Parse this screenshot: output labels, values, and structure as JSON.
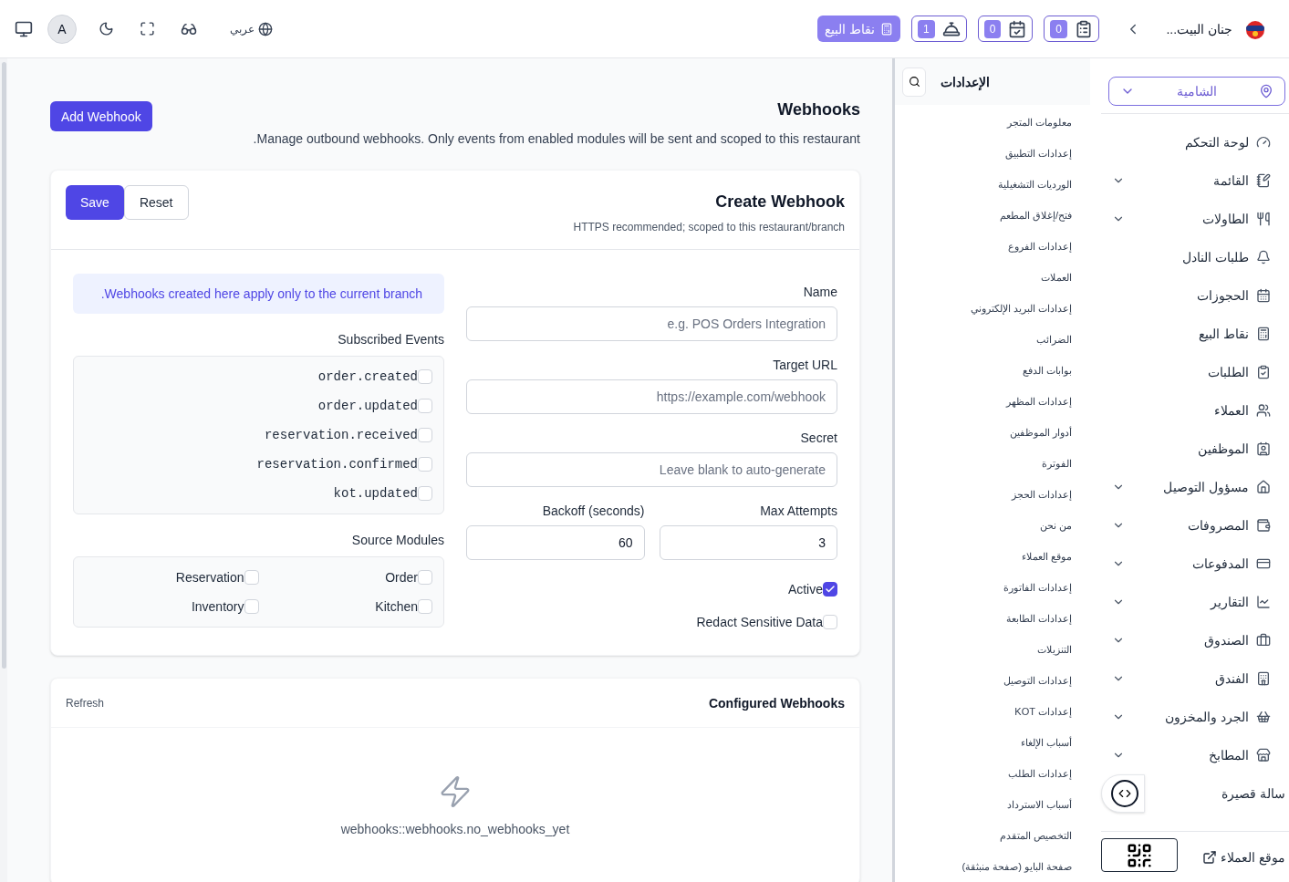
{
  "topbar": {
    "restaurant_name": "جنان البيت...",
    "counters": [
      {
        "kind": "orders",
        "value": "0"
      },
      {
        "kind": "reservations",
        "value": "0"
      },
      {
        "kind": "waiter",
        "value": "1"
      }
    ],
    "pos_button": "نقاط البيع",
    "language": "عربي",
    "avatar": "A"
  },
  "sidebar": {
    "branch": "الشامية",
    "items": [
      {
        "label": "لوحة التحكم",
        "expandable": false
      },
      {
        "label": "القائمة",
        "expandable": true
      },
      {
        "label": "الطاولات",
        "expandable": true
      },
      {
        "label": "طلبات النادل",
        "expandable": false
      },
      {
        "label": "الحجوزات",
        "expandable": false
      },
      {
        "label": "نقاط البيع",
        "expandable": false
      },
      {
        "label": "الطلبات",
        "expandable": false
      },
      {
        "label": "العملاء",
        "expandable": false
      },
      {
        "label": "الموظفين",
        "expandable": false
      },
      {
        "label": "مسؤول التوصيل",
        "expandable": true
      },
      {
        "label": "المصروفات",
        "expandable": true
      },
      {
        "label": "المدفوعات",
        "expandable": true
      },
      {
        "label": "التقارير",
        "expandable": true
      },
      {
        "label": "الصندوق",
        "expandable": true
      },
      {
        "label": "الفندق",
        "expandable": true
      },
      {
        "label": "الجرد والمخزون",
        "expandable": true
      },
      {
        "label": "المطابخ",
        "expandable": true
      },
      {
        "label": "سالة قصيرة",
        "expandable": false
      }
    ],
    "customer_site_link": "موقع العملاء"
  },
  "settings_menu": {
    "title": "الإعدادات",
    "items": [
      "معلومات المتجر",
      "إعدادات التطبيق",
      "الورديات التشغيلية",
      "فتح/إغلاق المطعم",
      "إعدادات الفروع",
      "العملات",
      "إعدادات البريد الإلكتروني",
      "الضرائب",
      "بوابات الدفع",
      "إعدادات المظهر",
      "أدوار الموظفين",
      "الفوترة",
      "إعدادات الحجز",
      "من نحن",
      "موقع العملاء",
      "إعدادات الفاتورة",
      "إعدادات الطابعة",
      "التنزيلات",
      "إعدادات التوصيل",
      "إعدادات KOT",
      "أسباب الإلغاء",
      "إعدادات الطلب",
      "أسباب الاسترداد",
      "التخصيص المتقدم",
      "صفحة البايو (صفحة منبثقة)"
    ]
  },
  "page": {
    "title": "Webhooks",
    "description": "Manage outbound webhooks. Only events from enabled modules will be sent and scoped to this restaurant.",
    "add_button": "Add Webhook",
    "create_card": {
      "title": "Create Webhook",
      "subtitle": "HTTPS recommended; scoped to this restaurant/branch",
      "save_button": "Save",
      "reset_button": "Reset",
      "note": "Webhooks created here apply only to the current branch.",
      "name": {
        "label": "Name",
        "placeholder": "e.g. POS Orders Integration"
      },
      "target_url": {
        "label": "Target URL",
        "placeholder": "https://example.com/webhook"
      },
      "secret": {
        "label": "Secret",
        "placeholder": "Leave blank to auto-generate"
      },
      "max_attempts": {
        "label": "Max Attempts",
        "value": "3"
      },
      "backoff": {
        "label": "Backoff (seconds)",
        "value": "60"
      },
      "toggles": [
        {
          "label": "Active",
          "checked": true
        },
        {
          "label": "Redact Sensitive Data",
          "checked": false
        }
      ],
      "events_label": "Subscribed Events",
      "events": [
        {
          "label": "order.created",
          "checked": false
        },
        {
          "label": "order.updated",
          "checked": false
        },
        {
          "label": "reservation.received",
          "checked": false
        },
        {
          "label": "reservation.confirmed",
          "checked": false
        },
        {
          "label": "kot.updated",
          "checked": false
        }
      ],
      "modules_label": "Source Modules",
      "modules": [
        {
          "label": "Order",
          "checked": false
        },
        {
          "label": "Reservation",
          "checked": false
        },
        {
          "label": "Kitchen",
          "checked": false
        },
        {
          "label": "Inventory",
          "checked": false
        }
      ]
    },
    "list_card": {
      "title": "Configured Webhooks",
      "refresh": "Refresh",
      "empty_text": "webhooks::webhooks.no_webhooks_yet"
    }
  }
}
